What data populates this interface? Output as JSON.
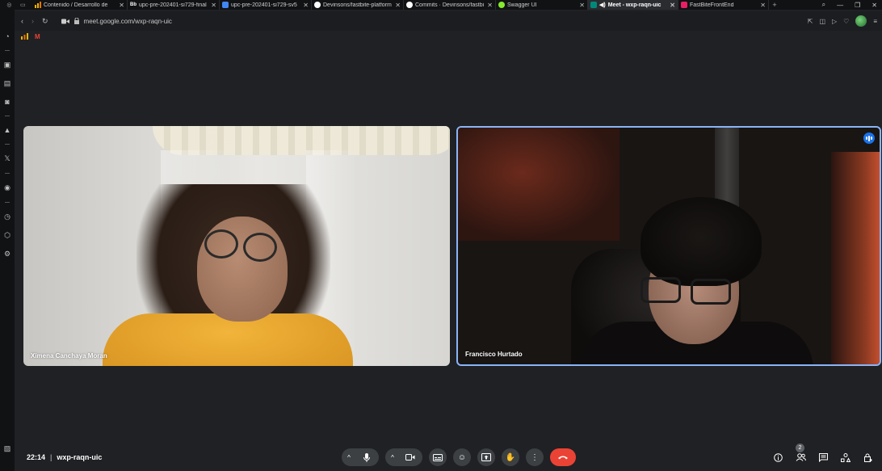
{
  "browser": {
    "tabs": [
      {
        "label": "Contenido / Desarrollo de",
        "favicon": "chart-favicon",
        "color": "#f5b400",
        "active": false
      },
      {
        "label": "upc-pre-202401-si729-final",
        "favicon": "bb-favicon",
        "badge": "Bb",
        "color": "#111111",
        "active": false
      },
      {
        "label": "upc-pre-202401-si729-sv5",
        "favicon": "docs-favicon",
        "color": "#4285f4",
        "active": false
      },
      {
        "label": "Devinsons/fastbite-platform",
        "favicon": "github-favicon",
        "color": "#ffffff",
        "active": false
      },
      {
        "label": "Commits · Devinsons/fastbi",
        "favicon": "github-favicon",
        "color": "#ffffff",
        "active": false
      },
      {
        "label": "Swagger UI",
        "favicon": "swagger-favicon",
        "color": "#85ea2d",
        "active": false
      },
      {
        "label": "Meet - wxp-raqn-uic",
        "favicon": "meet-favicon",
        "color": "#00897b",
        "active": true
      },
      {
        "label": "FastBiteFrontEnd",
        "favicon": "app-favicon",
        "color": "#e91e63",
        "active": false
      }
    ],
    "url": "meet.google.com/wxp-raqn-uic"
  },
  "tiles": {
    "left_name": "Ximena Canchaya Moran",
    "right_name": "Francisco Hurtado"
  },
  "bottom": {
    "time": "22:14",
    "separator": "|",
    "meeting_code": "wxp-raqn-uic",
    "participants_count": "2"
  },
  "colors": {
    "accent": "#8ab4f8",
    "end_call": "#ea4335",
    "background": "#202124",
    "control": "#3c4043"
  }
}
